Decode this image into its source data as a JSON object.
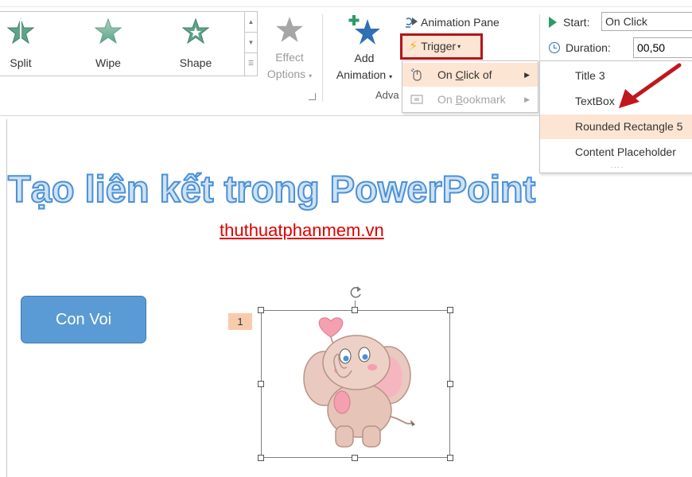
{
  "ribbon": {
    "gallery": {
      "items": [
        {
          "label": "Split",
          "icon": "split-star-icon"
        },
        {
          "label": "Wipe",
          "icon": "wipe-star-icon"
        },
        {
          "label": "Shape",
          "icon": "shape-star-icon"
        }
      ]
    },
    "effect_options": {
      "line1": "Effect",
      "line2": "Options"
    },
    "add_animation": {
      "line1": "Add",
      "line2": "Animation"
    },
    "advanced_group_label": "Adva",
    "animation_pane": "Animation Pane",
    "trigger": "Trigger",
    "timing": {
      "start_label": "Start:",
      "start_value": "On Click",
      "duration_label": "Duration:",
      "duration_value": "00,50"
    }
  },
  "trigger_menu": {
    "items": [
      {
        "prefix": "On ",
        "underline": "C",
        "rest": "lick of",
        "state": "highlighted"
      },
      {
        "prefix": "On ",
        "underline": "B",
        "rest": "ookmark",
        "state": "disabled"
      }
    ]
  },
  "submenu": {
    "items": [
      "Title 3",
      "TextBox",
      "Rounded Rectangle 5",
      "Content Placeholder"
    ],
    "highlighted_index": 2
  },
  "slide": {
    "title": "Tạo liên kết trong PowerPoint",
    "link": "thuthuatphanmem.vn",
    "button_label": "Con Voi",
    "animation_tag": "1"
  },
  "colors": {
    "trigger_border": "#b3141b",
    "highlight": "#fde5d4",
    "shape_fill": "#5b9bd5",
    "link": "#e00000",
    "title_stroke": "#4a90d9"
  }
}
